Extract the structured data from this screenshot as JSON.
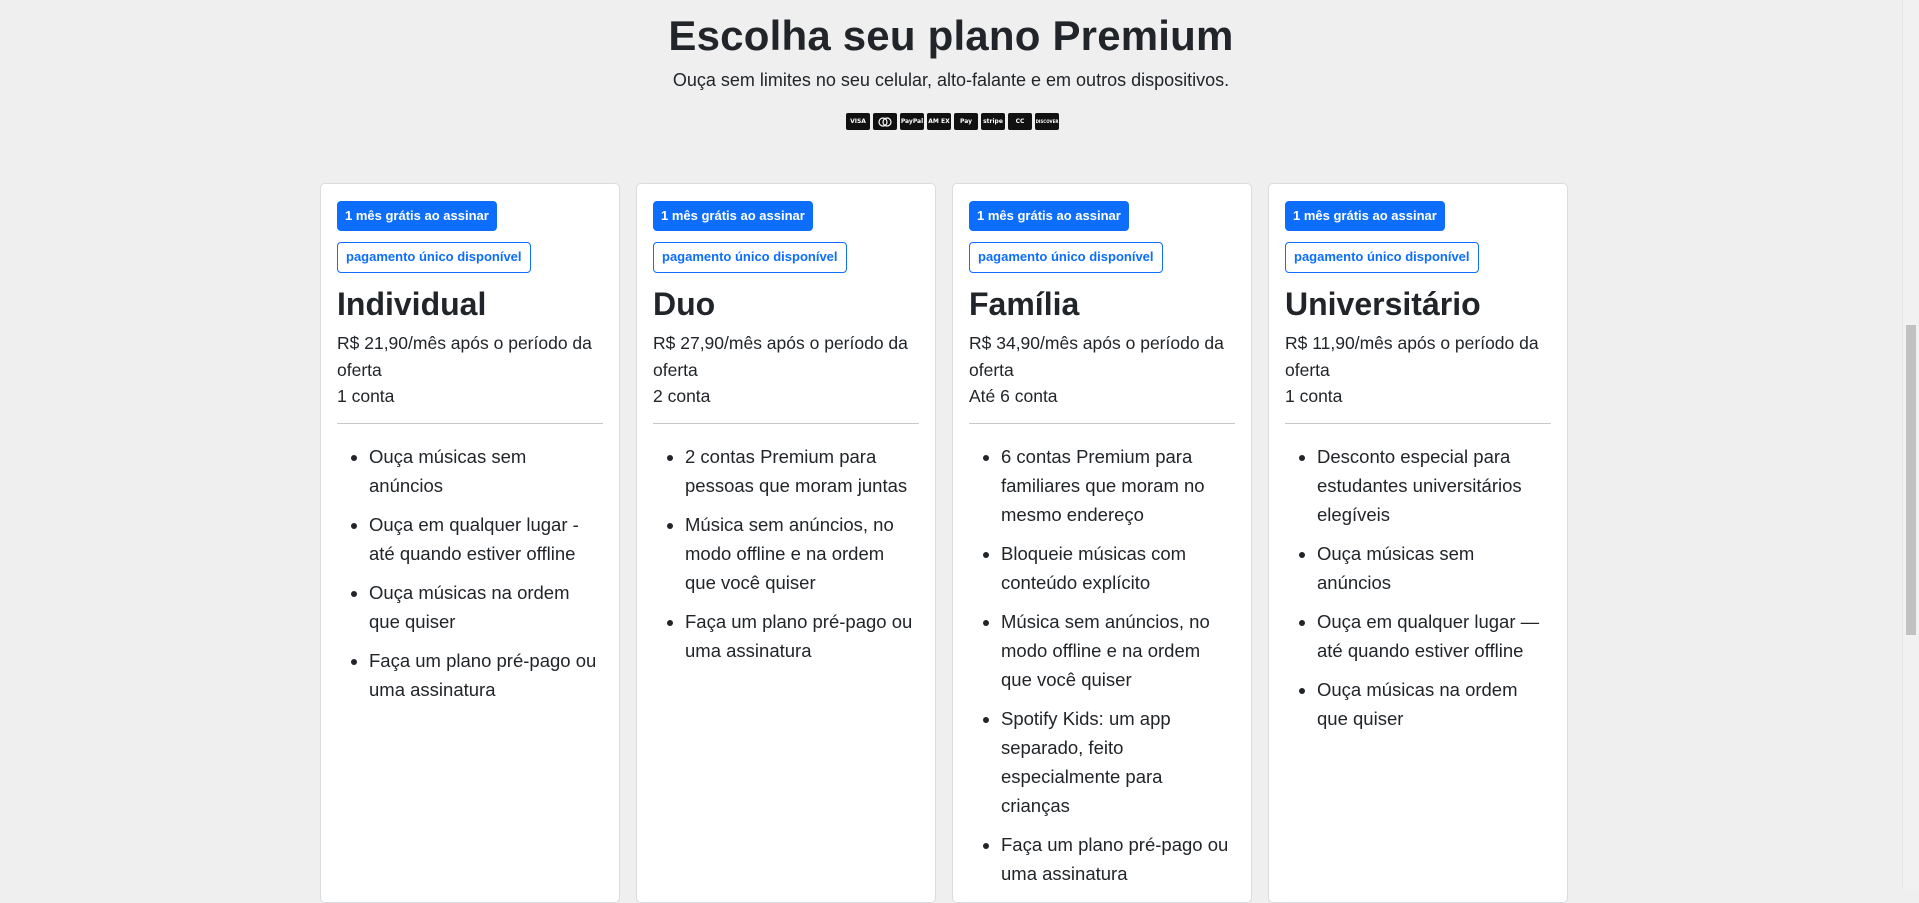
{
  "header": {
    "title": "Escolha seu plano Premium",
    "subtitle": "Ouça sem limites no seu celular, alto-falante e em outros dispositivos."
  },
  "payment_methods": [
    {
      "name": "visa-icon",
      "label": "VISA"
    },
    {
      "name": "mastercard-icon",
      "label": ""
    },
    {
      "name": "paypal-icon",
      "label": "PayPal"
    },
    {
      "name": "amex-icon",
      "label": "AM EX"
    },
    {
      "name": "apple-pay-icon",
      "label": "Pay"
    },
    {
      "name": "stripe-icon",
      "label": "stripe"
    },
    {
      "name": "cc-icon",
      "label": "CC"
    },
    {
      "name": "discover-icon",
      "label": "DISCOVER"
    }
  ],
  "plans": [
    {
      "badge_trial": "1 mês grátis ao assinar",
      "badge_payment": "pagamento único disponível",
      "name": "Individual",
      "price": "R$ 21,90/mês após o período da oferta",
      "accounts": "1 conta",
      "features": [
        "Ouça músicas sem anúncios",
        "Ouça em qualquer lugar - até quando estiver offline",
        "Ouça músicas na ordem que quiser",
        "Faça um plano pré-pago ou uma assinatura"
      ]
    },
    {
      "badge_trial": "1 mês grátis ao assinar",
      "badge_payment": "pagamento único disponível",
      "name": "Duo",
      "price": "R$ 27,90/mês após o período da oferta",
      "accounts": "2 conta",
      "features": [
        "2 contas Premium para pessoas que moram juntas",
        "Música sem anúncios, no modo offline e na ordem que você quiser",
        "Faça um plano pré-pago ou uma assinatura"
      ]
    },
    {
      "badge_trial": "1 mês grátis ao assinar",
      "badge_payment": "pagamento único disponível",
      "name": "Família",
      "price": "R$ 34,90/mês após o período da oferta",
      "accounts": "Até 6 conta",
      "features": [
        "6 contas Premium para familiares que moram no mesmo endereço",
        "Bloqueie músicas com conteúdo explícito",
        "Música sem anúncios, no modo offline e na ordem que você quiser",
        "Spotify Kids: um app separado, feito especialmente para crianças",
        "Faça um plano pré-pago ou uma assinatura"
      ]
    },
    {
      "badge_trial": "1 mês grátis ao assinar",
      "badge_payment": "pagamento único disponível",
      "name": "Universitário",
      "price": "R$ 11,90/mês após o período da oferta",
      "accounts": "1 conta",
      "features": [
        "Desconto especial para estudantes universitários elegíveis",
        "Ouça músicas sem anúncios",
        "Ouça em qualquer lugar — até quando estiver offline",
        "Ouça músicas na ordem que quiser"
      ]
    }
  ]
}
